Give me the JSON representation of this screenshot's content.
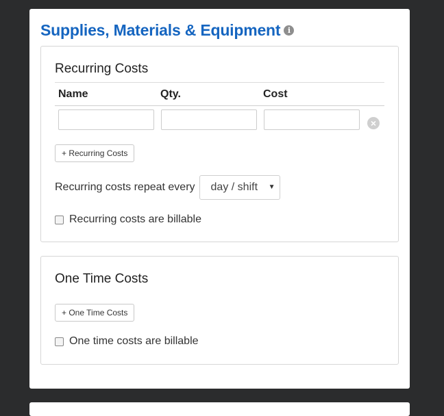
{
  "section": {
    "title": "Supplies, Materials & Equipment",
    "info_icon": "i"
  },
  "recurring": {
    "title": "Recurring Costs",
    "columns": [
      "Name",
      "Qty.",
      "Cost"
    ],
    "row": {
      "name": "",
      "qty": "",
      "cost": ""
    },
    "remove_icon": "×",
    "add_button": "+ Recurring Costs",
    "repeat_label": "Recurring costs repeat every",
    "repeat_value": "day / shift",
    "caret": "▼",
    "billable_label": "Recurring costs are billable",
    "billable_checked": false
  },
  "onetime": {
    "title": "One Time Costs",
    "add_button": "+ One Time Costs",
    "billable_label": "One time costs are billable",
    "billable_checked": false
  }
}
